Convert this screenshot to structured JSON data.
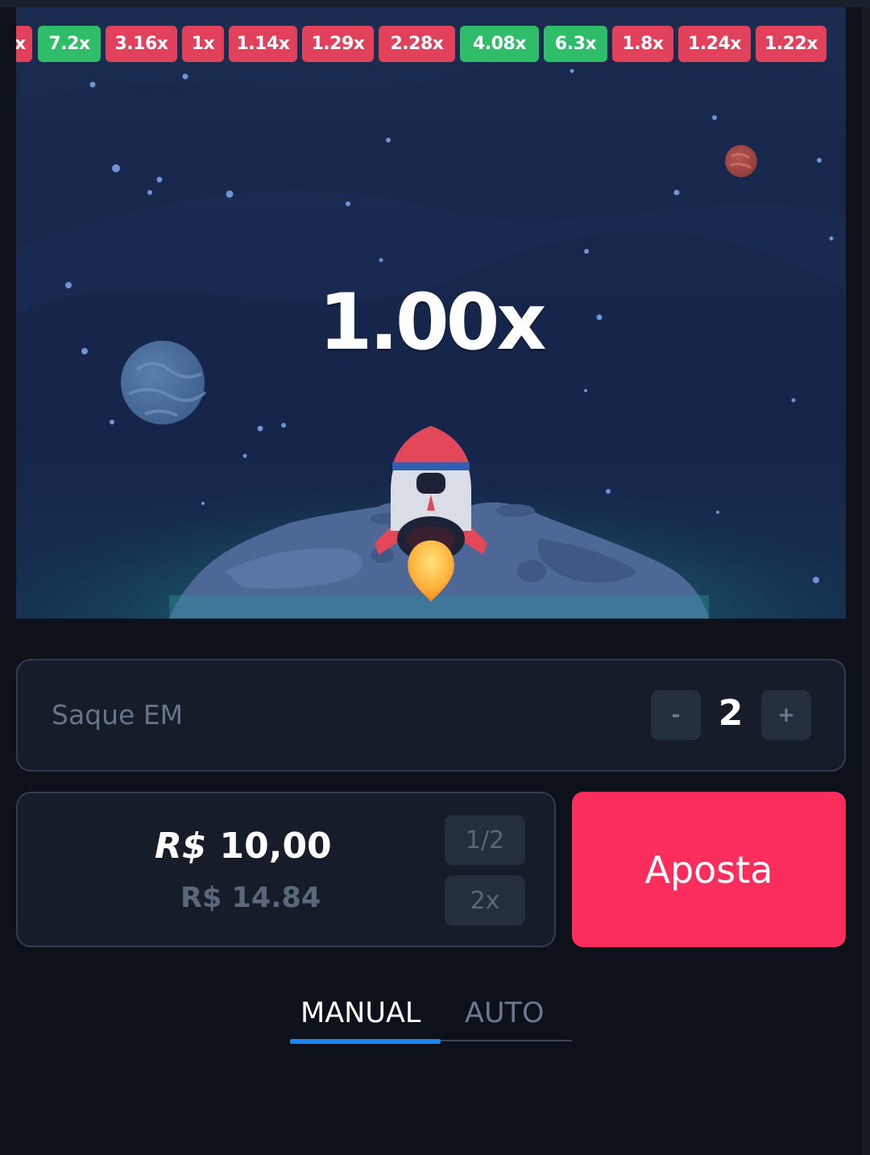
{
  "history": [
    {
      "label": "x",
      "color": "red"
    },
    {
      "label": "7.2x",
      "color": "green"
    },
    {
      "label": "3.16x",
      "color": "red"
    },
    {
      "label": "1x",
      "color": "red"
    },
    {
      "label": "1.14x",
      "color": "red"
    },
    {
      "label": "1.29x",
      "color": "red"
    },
    {
      "label": "2.28x",
      "color": "red"
    },
    {
      "label": "4.08x",
      "color": "green"
    },
    {
      "label": "6.3x",
      "color": "green"
    },
    {
      "label": "1.8x",
      "color": "red"
    },
    {
      "label": "1.24x",
      "color": "red"
    },
    {
      "label": "1.22x",
      "color": "red"
    }
  ],
  "game": {
    "multiplier": "1.00x"
  },
  "cashout": {
    "label": "Saque EM",
    "minus": "-",
    "value": "2",
    "plus": "+"
  },
  "bet": {
    "currency": "R$",
    "amount": "10,00",
    "balance": "R$ 14.84",
    "half_label": "1/2",
    "double_label": "2x",
    "button_label": "Aposta"
  },
  "tabs": {
    "manual": "MANUAL",
    "auto": "AUTO",
    "active": "MANUAL"
  },
  "colors": {
    "chip_red": "#e2415c",
    "chip_green": "#2fbd6a",
    "bet_button": "#fa2d5d",
    "tab_active": "#1e84f0"
  }
}
